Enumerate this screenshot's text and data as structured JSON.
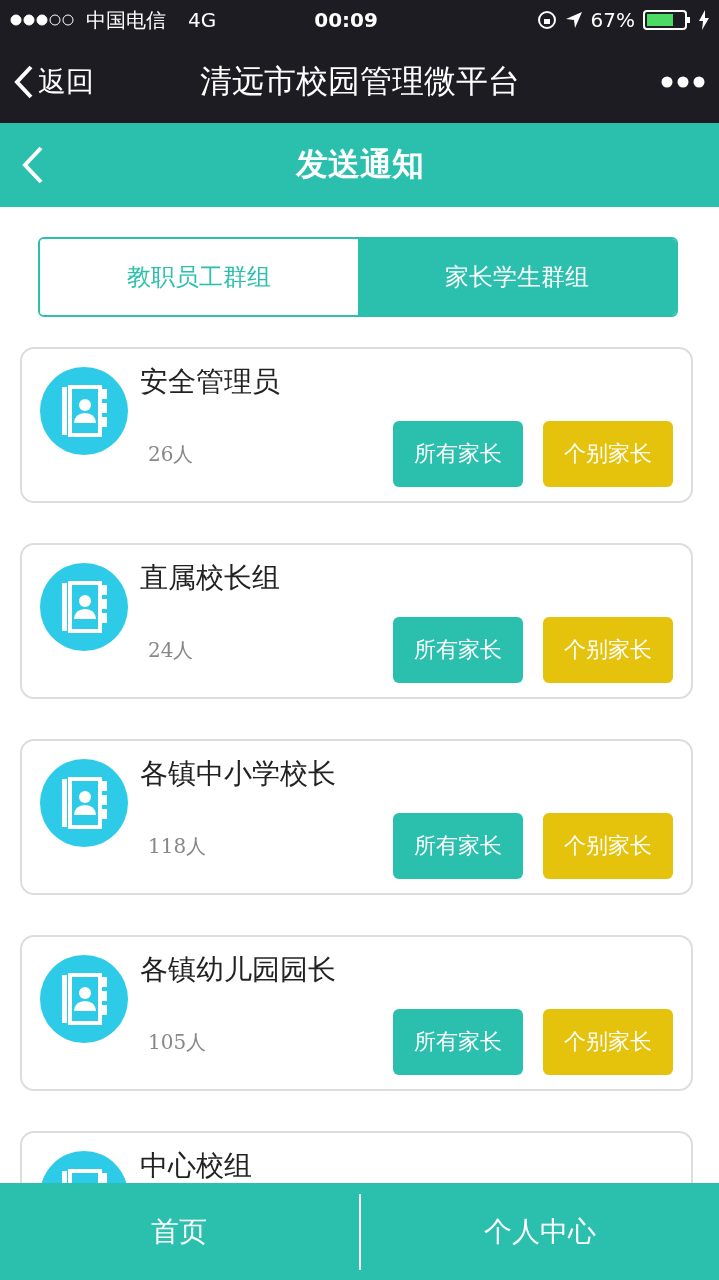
{
  "status_bar": {
    "carrier": "中国电信",
    "network": "4G",
    "time": "00:09",
    "battery": "67%"
  },
  "nav_bar": {
    "back": "返回",
    "title": "清远市校园管理微平台"
  },
  "header": {
    "title": "发送通知"
  },
  "tabs": [
    {
      "label": "教职员工群组",
      "selected": false
    },
    {
      "label": "家长学生群组",
      "selected": true
    }
  ],
  "groups": [
    {
      "name": "安全管理员",
      "count": "26人",
      "actions": [
        "所有家长",
        "个别家长"
      ]
    },
    {
      "name": "直属校长组",
      "count": "24人",
      "actions": [
        "所有家长",
        "个别家长"
      ]
    },
    {
      "name": "各镇中小学校长",
      "count": "118人",
      "actions": [
        "所有家长",
        "个别家长"
      ]
    },
    {
      "name": "各镇幼儿园园长",
      "count": "105人",
      "actions": [
        "所有家长",
        "个别家长"
      ]
    },
    {
      "name": "中心校组"
    }
  ],
  "bottom_nav": [
    "首页",
    "个人中心"
  ]
}
